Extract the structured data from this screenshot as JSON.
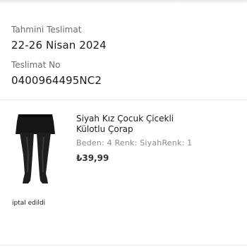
{
  "delivery": {
    "estimated_label": "Tahmini Teslimat",
    "estimated_value": "22-26 Nisan 2024",
    "tracking_label": "Teslimat No",
    "tracking_value": "0400964495NC2"
  },
  "product": {
    "image_icon": "tights-product-image",
    "title_line1": "Siyah Kız Çocuk Çicekli",
    "title_line2": "Külotlu Çorap",
    "variant": "Beden: 4 Renk: SiyahRenk: 1",
    "price": "₺39,99",
    "status": "iptal edildi"
  }
}
